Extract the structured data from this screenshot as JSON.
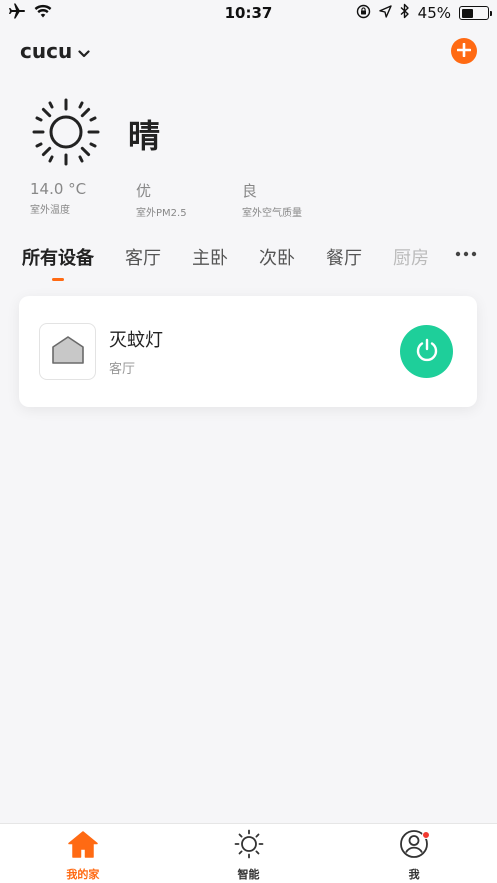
{
  "status_bar": {
    "time": "10:37",
    "battery_text": "45%",
    "battery_level": 0.45,
    "icons": [
      "airplane-icon",
      "wifi-icon",
      "rotation-lock-icon",
      "location-icon",
      "bluetooth-icon",
      "battery-icon"
    ]
  },
  "header": {
    "home_name": "cucu",
    "add_icon": "plus-icon",
    "accent_color": "#ff6a13"
  },
  "weather": {
    "icon": "sun-icon",
    "condition": "晴"
  },
  "metrics": [
    {
      "value": "14.0 °C",
      "label": "室外温度"
    },
    {
      "value": "优",
      "label": "室外PM2.5"
    },
    {
      "value": "良",
      "label": "室外空气质量"
    }
  ],
  "tabs": [
    {
      "label": "所有设备",
      "active": true
    },
    {
      "label": "客厅"
    },
    {
      "label": "主卧"
    },
    {
      "label": "次卧"
    },
    {
      "label": "餐厅"
    },
    {
      "label": "厨房"
    }
  ],
  "devices": [
    {
      "name": "灭蚊灯",
      "room": "客厅",
      "icon": "house-icon",
      "power_icon": "power-icon",
      "power_color": "#1ecf9a"
    }
  ],
  "tab_bar": [
    {
      "label": "我的家",
      "icon": "home-icon",
      "active": true
    },
    {
      "label": "智能",
      "icon": "sun-outline-icon"
    },
    {
      "label": "我",
      "icon": "profile-icon",
      "badge": true
    }
  ]
}
